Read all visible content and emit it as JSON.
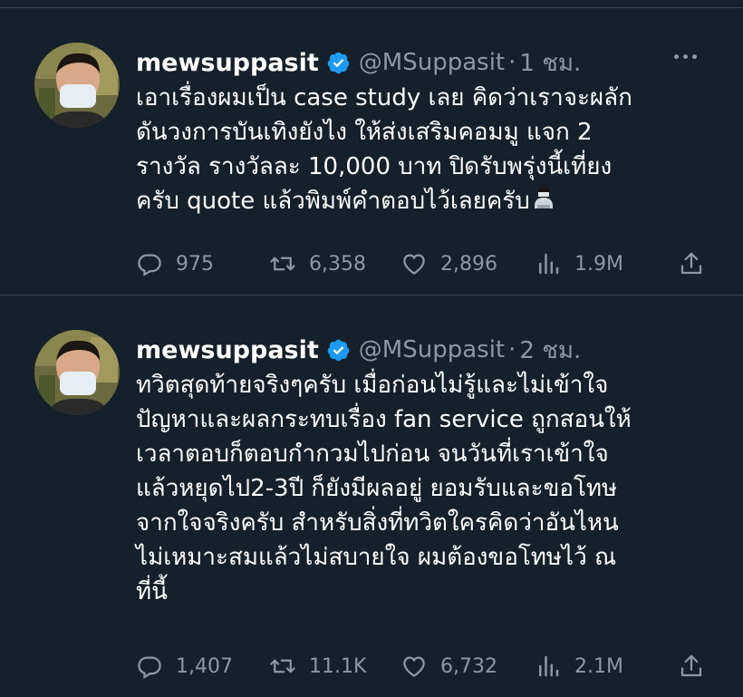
{
  "tweets": [
    {
      "display_name": "mewsuppasit",
      "handle": "@MSuppasit",
      "separator": "·",
      "time": "1 ชม.",
      "text": "เอาเรื่องผมเป็น case study เลย คิดว่าเราจะผลัก\nดันวงการบันเทิงยังไง ให้ส่งเสริมคอมมู แจก 2\nรางวัล รางวัลละ 10,000 บาท ปิดรับพรุ่งนี้เที่ยง\nครับ quote แล้วพิมพ์คำตอบไว้เลยครับ",
      "emoji": "person-bowing-emoji",
      "replies": "975",
      "retweets": "6,358",
      "likes": "2,896",
      "views": "1.9M"
    },
    {
      "display_name": "mewsuppasit",
      "handle": "@MSuppasit",
      "separator": "·",
      "time": "2 ชม.",
      "text": "ทวิตสุดท้ายจริงๆครับ เมื่อก่อนไม่รู้และไม่เข้าใจ\nปัญหาและผลกระทบเรื่อง fan service ถูกสอนให้\nเวลาตอบก็ตอบกำกวมไปก่อน จนวันที่เราเข้าใจ\nแล้วหยุดไป2-3ปี ก็ยังมีผลอยู่ ยอมรับและขอโทษ\nจากใจจริงครับ สำหรับสิ่งที่ทวิตใครคิดว่าอันไหน\nไม่เหมาะสมแล้วไม่สบายใจ ผมต้องขอโทษไว้ ณ\nที่นี้",
      "replies": "1,407",
      "retweets": "11.1K",
      "likes": "6,732",
      "views": "2.1M"
    }
  ],
  "colors": {
    "background": "#15202b",
    "secondary_text": "#8b98a5",
    "verified_blue": "#1d9bf0",
    "divider": "#38444d"
  },
  "icons": [
    "more-icon",
    "verified-icon",
    "reply-icon",
    "retweet-icon",
    "like-icon",
    "views-icon",
    "share-icon"
  ]
}
